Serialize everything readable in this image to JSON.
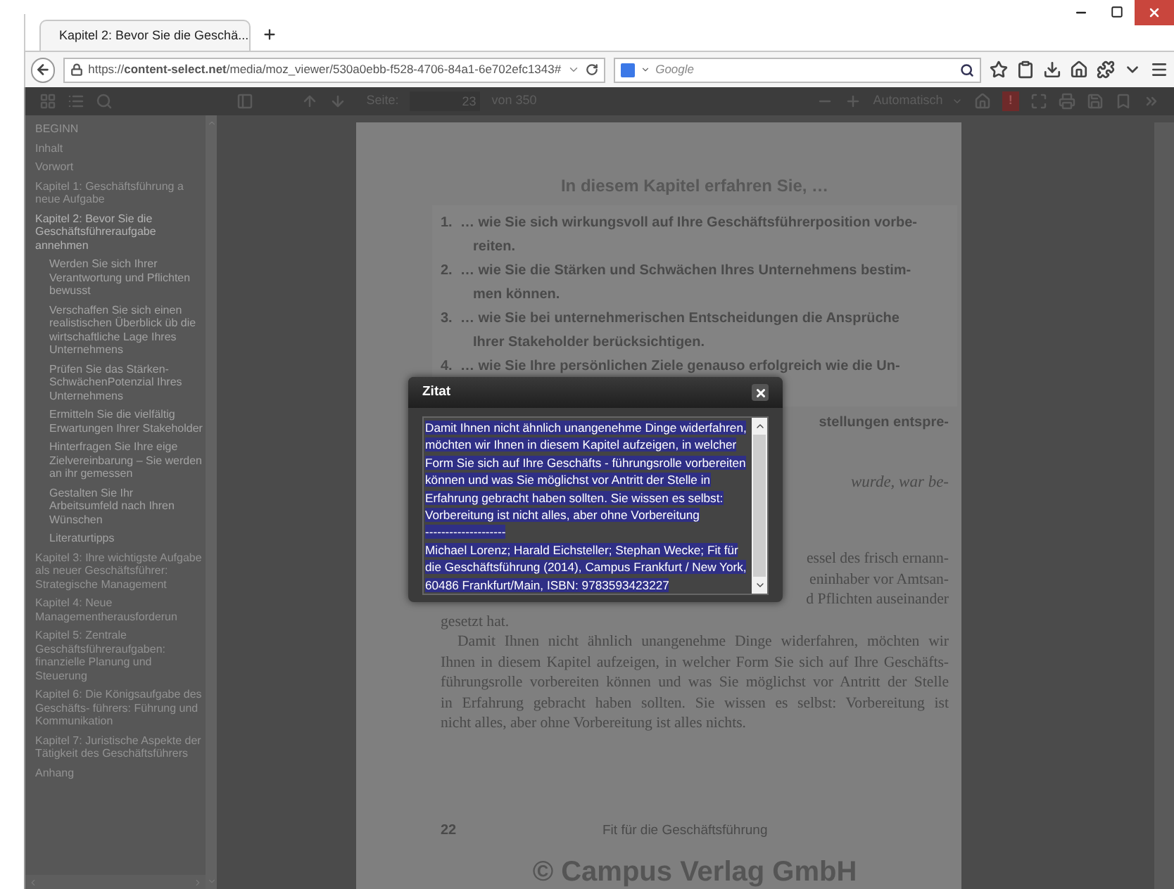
{
  "browser": {
    "tab": {
      "title": "Kapitel 2: Bevor Sie die Geschä...",
      "selected": true
    },
    "url": "https://**content-select.net**/media/moz_viewer/530a0ebb-f528-4706-84a1-6e702efc1343#",
    "search": {
      "placeholder": "Google"
    }
  },
  "toolbar": {
    "page_label": "Seite:",
    "page_input": "23",
    "page_total": "von 350",
    "zoom": "Automatisch",
    "alert": "!"
  },
  "sidebar": {
    "items": [
      {
        "label": "BEGINN",
        "selected": false
      },
      {
        "label": "Inhalt",
        "selected": false
      },
      {
        "label": "Vorwort",
        "selected": false
      },
      {
        "label": "Kapitel 1: Geschäftsführung a neue Aufgabe",
        "selected": false
      },
      {
        "label": "Kapitel 2: Bevor Sie die Geschäftsführeraufgabe annehmen",
        "selected": true,
        "children": [
          {
            "label": "Werden Sie sich Ihrer Verantwortung und Pflichten bewusst",
            "selected": false
          },
          {
            "label": "Verschaffen Sie sich einen realistischen Überblick üb die wirtschaftliche Lage Ihres Unternehmens",
            "selected": false
          },
          {
            "label": "Prüfen Sie das Stärken-SchwächenPotenzial Ihres Unternehmens",
            "selected": false
          },
          {
            "label": "Ermitteln Sie die vielfältig Erwartungen Ihrer Stakeholder",
            "selected": false
          },
          {
            "label": "Hinterfragen Sie Ihre eige Zielvereinbarung – Sie werden an ihr gemessen",
            "selected": false
          },
          {
            "label": "Gestalten Sie Ihr Arbeitsumfeld nach Ihren Wünschen",
            "selected": false
          },
          {
            "label": "Literaturtipps",
            "selected": false
          }
        ]
      },
      {
        "label": "Kapitel 3: Ihre wichtigste Aufgabe als neuer Geschäftsführer: Strategische Management",
        "selected": false
      },
      {
        "label": "Kapitel 4: Neue Managementherausforderun",
        "selected": false
      },
      {
        "label": "Kapitel 5: Zentrale Geschäftsführeraufgaben: finanzielle Planung und Steuerung",
        "selected": false
      },
      {
        "label": "Kapitel 6: Die Königsaufgabe des Geschäfts- führers: Führung und Kommunikation",
        "selected": false
      },
      {
        "label": "Kapitel 7: Juristische Aspekte der Tätigkeit des Geschäftsführers",
        "selected": false
      },
      {
        "label": "Anhang",
        "selected": false
      }
    ]
  },
  "page": {
    "heading": "In diesem Kapitel erfahren Sie, …",
    "goals": [
      {
        "number": "1.",
        "lines": [
          "… wie Sie sich wirkungsvoll auf Ihre Geschäftsführerposition vorbe-",
          "reiten."
        ]
      },
      {
        "number": "2.",
        "lines": [
          "… wie Sie die Stärken und Schwächen Ihres Unternehmens bestim-",
          "men können."
        ]
      },
      {
        "number": "3.",
        "lines": [
          "… wie Sie bei unternehmerischen Entscheidungen die Ansprüche",
          "Ihrer Stakeholder berücksichtigen."
        ]
      },
      {
        "number": "4.",
        "lines": [
          "… wie Sie Ihre persönlichen Ziele genauso erfolgreich wie die Un-"
        ]
      }
    ],
    "fragments": [
      {
        "kind": "sans",
        "text": "stellungen entspre-"
      },
      {
        "kind": "italic",
        "text": "wurde, war be-"
      },
      {
        "kind": "serif",
        "text": "essel des frisch ernann-"
      },
      {
        "kind": "serif",
        "text": "eninhaber vor Amtsan-"
      },
      {
        "kind": "serif",
        "text": "d Pflichten auseinander"
      }
    ],
    "body_lines": [
      "gesetzt hat.",
      "Damit Ihnen nicht ähnlich unangenehme Dinge widerfahren, möchten wir",
      "Ihnen in diesem Kapitel aufzeigen, in welcher Form Sie sich auf Ihre Geschäfts-",
      "führungsrolle vorbereiten können und was Sie möglichst vor Antritt der Stelle",
      "in Erfahrung gebracht haben sollten. Sie wissen es selbst: Vorbereitung ist",
      "nicht alles, aber ohne Vorbereitung ist alles nichts."
    ],
    "page_number": "22",
    "running_title": "Fit für die Geschäftsführung",
    "copyright": "© Campus Verlag GmbH"
  },
  "dialog": {
    "title": "Zitat",
    "quote": "Damit Ihnen nicht ähnlich unangenehme Dinge widerfahren, möchten wir Ihnen in diesem Kapitel aufzeigen, in welcher Form Sie sich auf Ihre Geschäfts - führungsrolle vorbereiten können und was Sie möglichst vor Antritt der Stelle in Erfahrung gebracht haben sollten. Sie wissen es selbst: Vorbereitung ist nicht alles, aber ohne Vorbereitung",
    "separator": "--------------------",
    "citation": "Michael Lorenz; Harald Eichsteller; Stephan Wecke; Fit für die Geschäftsführung (2014), Campus Frankfurt / New York, 60486 Frankfurt/Main, ISBN: 9783593423227"
  }
}
